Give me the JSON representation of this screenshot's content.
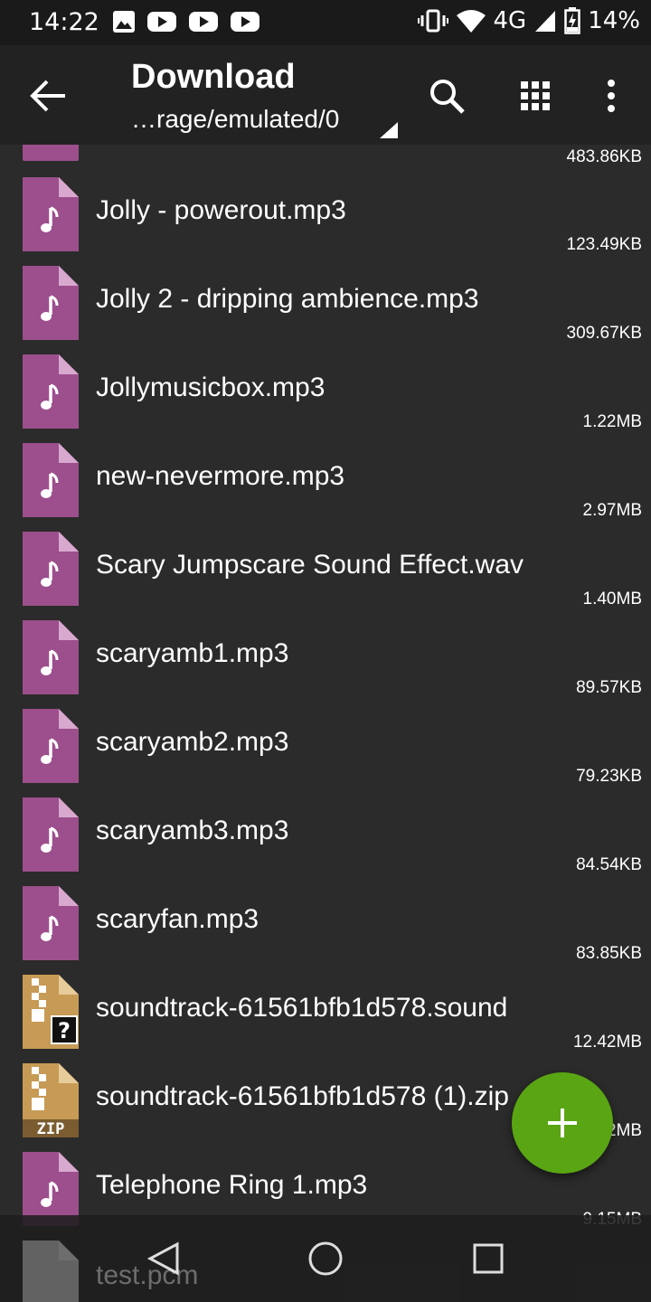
{
  "status_bar": {
    "time": "14:22",
    "network": "4G",
    "battery": "14%",
    "notification_icons": [
      "gallery-icon",
      "youtube-icon",
      "youtube-icon",
      "youtube-icon"
    ]
  },
  "app_bar": {
    "title": "Download",
    "path": "…rage/emulated/0",
    "actions": [
      "search-icon",
      "grid-view-icon",
      "more-options-icon"
    ]
  },
  "partial_row": {
    "size": "483.86KB"
  },
  "files": [
    {
      "name": "Jolly - powerout.mp3",
      "size": "123.49KB",
      "type": "audio"
    },
    {
      "name": "Jolly 2 - dripping ambience.mp3",
      "size": "309.67KB",
      "type": "audio"
    },
    {
      "name": "Jollymusicbox.mp3",
      "size": "1.22MB",
      "type": "audio"
    },
    {
      "name": "new-nevermore.mp3",
      "size": "2.97MB",
      "type": "audio"
    },
    {
      "name": "Scary Jumpscare Sound Effect.wav",
      "size": "1.40MB",
      "type": "audio"
    },
    {
      "name": "scaryamb1.mp3",
      "size": "89.57KB",
      "type": "audio"
    },
    {
      "name": "scaryamb2.mp3",
      "size": "79.23KB",
      "type": "audio"
    },
    {
      "name": "scaryamb3.mp3",
      "size": "84.54KB",
      "type": "audio"
    },
    {
      "name": "scaryfan.mp3",
      "size": "83.85KB",
      "type": "audio"
    },
    {
      "name": "soundtrack-61561bfb1d578.sound",
      "size": "12.42MB",
      "type": "unknown-archive"
    },
    {
      "name": "soundtrack-61561bfb1d578 (1).zip",
      "size": "12.42MB",
      "type": "zip"
    },
    {
      "name": "Telephone Ring 1.mp3",
      "size": "9.15MB",
      "type": "audio"
    }
  ],
  "last_file": {
    "name": "test.pcm",
    "type": "generic"
  },
  "zip_label": "ZIP",
  "unknown_label": "?",
  "colors": {
    "audio_icon": "#9c4f8c",
    "archive_icon": "#c79a55",
    "fab": "#5aa513",
    "background": "#2b2b2b",
    "app_bar": "#222222"
  }
}
